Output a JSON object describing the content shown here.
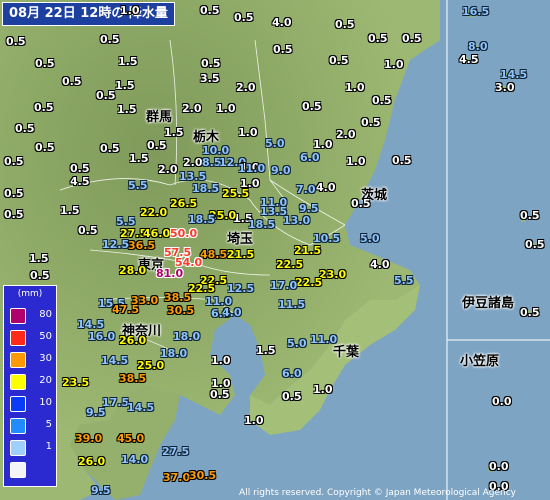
{
  "title": "08月 22日 12時の 降水量",
  "copyright": "All rights reserved. Copyright © Japan Meteorological Agency",
  "legend": {
    "unit": "(mm)",
    "entries": [
      {
        "label": "80",
        "color": "#b0006e"
      },
      {
        "label": "50",
        "color": "#ff2a1a"
      },
      {
        "label": "30",
        "color": "#ff9900"
      },
      {
        "label": "20",
        "color": "#ffff00"
      },
      {
        "label": "10",
        "color": "#0a3cf5"
      },
      {
        "label": "5",
        "color": "#1f8cff"
      },
      {
        "label": "1",
        "color": "#9fd0ff"
      },
      {
        "label": "",
        "color": "#f4f4f8"
      }
    ]
  },
  "prefectures": [
    "群馬",
    "栃木",
    "茨城",
    "埼玉",
    "東京",
    "神奈川",
    "千葉",
    "伊豆諸島",
    "小笠原"
  ],
  "readings": [
    "1.0",
    "0.5",
    "0.5",
    "4.0",
    "0.5",
    "16.5",
    "0.5",
    "0.5",
    "0.5",
    "0.5",
    "8.0",
    "4.5",
    "0.5",
    "0.5",
    "0.5",
    "1.5",
    "0.5",
    "1.0",
    "14.5",
    "3.0",
    "3.5",
    "0.5",
    "0.5",
    "1.5",
    "2.0",
    "1.0",
    "0.5",
    "0.5",
    "1.5",
    "2.0",
    "1.0",
    "0.5",
    "0.5",
    "1.5",
    "2.0",
    "0.5",
    "1.0",
    "0.5",
    "0.5",
    "0.5",
    "1.0",
    "5.0",
    "1.5",
    "0.5",
    "0.5",
    "0.5",
    "1.0",
    "4.5",
    "10.0",
    "2.0",
    "8.5",
    "12.0",
    "2.0",
    "6.0",
    "1.0",
    "1.0",
    "9.0",
    "11.0",
    "1.5",
    "13.5",
    "5.5",
    "18.5",
    "7.0",
    "4.0",
    "0.5",
    "25.5",
    "1.5",
    "0.5",
    "26.5",
    "11.0",
    "13.5",
    "9.5",
    "0.5",
    "22.0",
    "25.0",
    "5.5",
    "18.5",
    "13.0",
    "0.5",
    "5.0",
    "27.5",
    "46.0",
    "50.0",
    "10.5",
    "12.5",
    "36.5",
    "18.5",
    "57.5",
    "48.5",
    "21.5",
    "21.5",
    "1.5",
    "54.0",
    "22.5",
    "4.0",
    "0.5",
    "28.0",
    "81.0",
    "23.0",
    "0.5",
    "5.5",
    "22.5",
    "22.5",
    "12.5",
    "17.0",
    "22.5",
    "15.5",
    "33.0",
    "0.5",
    "38.5",
    "11.0",
    "11.5",
    "47.5",
    "30.5",
    "0.5",
    "14.5",
    "6.5",
    "4.0",
    "16.0",
    "26.0",
    "18.0",
    "5.0",
    "11.0",
    "14.5",
    "18.0",
    "1.5",
    "25.0",
    "1.0",
    "23.5",
    "38.5",
    "6.0",
    "1.0",
    "17.5",
    "9.5",
    "0.5",
    "14.5",
    "0.5",
    "1.0",
    "0.0",
    "0.0",
    "39.0",
    "45.0",
    "1.0",
    "27.5",
    "26.0",
    "14.0",
    "0.0",
    "37.0",
    "30.5",
    "9.5"
  ]
}
